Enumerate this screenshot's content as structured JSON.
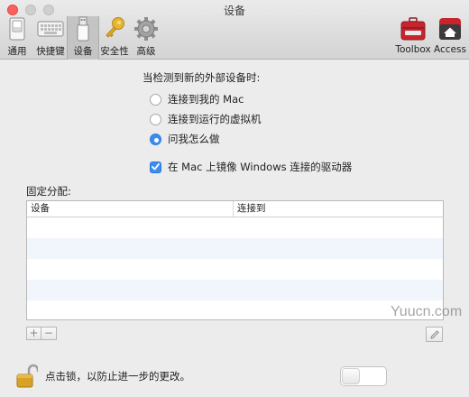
{
  "window": {
    "title": "设备"
  },
  "toolbar": {
    "items": [
      {
        "label": "通用",
        "icon": "general-switch-icon"
      },
      {
        "label": "快捷键",
        "icon": "keyboard-icon"
      },
      {
        "label": "设备",
        "icon": "usb-device-icon",
        "selected": true
      },
      {
        "label": "安全性",
        "icon": "key-icon"
      },
      {
        "label": "高级",
        "icon": "gear-icon"
      },
      {
        "label": "Toolbox",
        "icon": "toolbox-icon"
      },
      {
        "label": "Access",
        "icon": "access-home-icon"
      }
    ]
  },
  "devices": {
    "prompt": "当检测到新的外部设备时:",
    "options": [
      {
        "label": "连接到我的 Mac",
        "selected": false
      },
      {
        "label": "连接到运行的虚拟机",
        "selected": false
      },
      {
        "label": "问我怎么做",
        "selected": true
      }
    ],
    "mirror_checkbox": {
      "label": "在 Mac 上镜像 Windows 连接的驱动器",
      "checked": true
    }
  },
  "assignment": {
    "label": "固定分配:",
    "columns": [
      "设备",
      "连接到"
    ],
    "rows": []
  },
  "buttons": {
    "add": "+",
    "remove": "−"
  },
  "lock": {
    "text": "点击锁，以防止进一步的更改。"
  },
  "watermark": {
    "text": "Yuucn.com"
  },
  "colors": {
    "accent": "#3b8ef0",
    "close": "#fc605c",
    "toolbox_red": "#c8242e"
  }
}
